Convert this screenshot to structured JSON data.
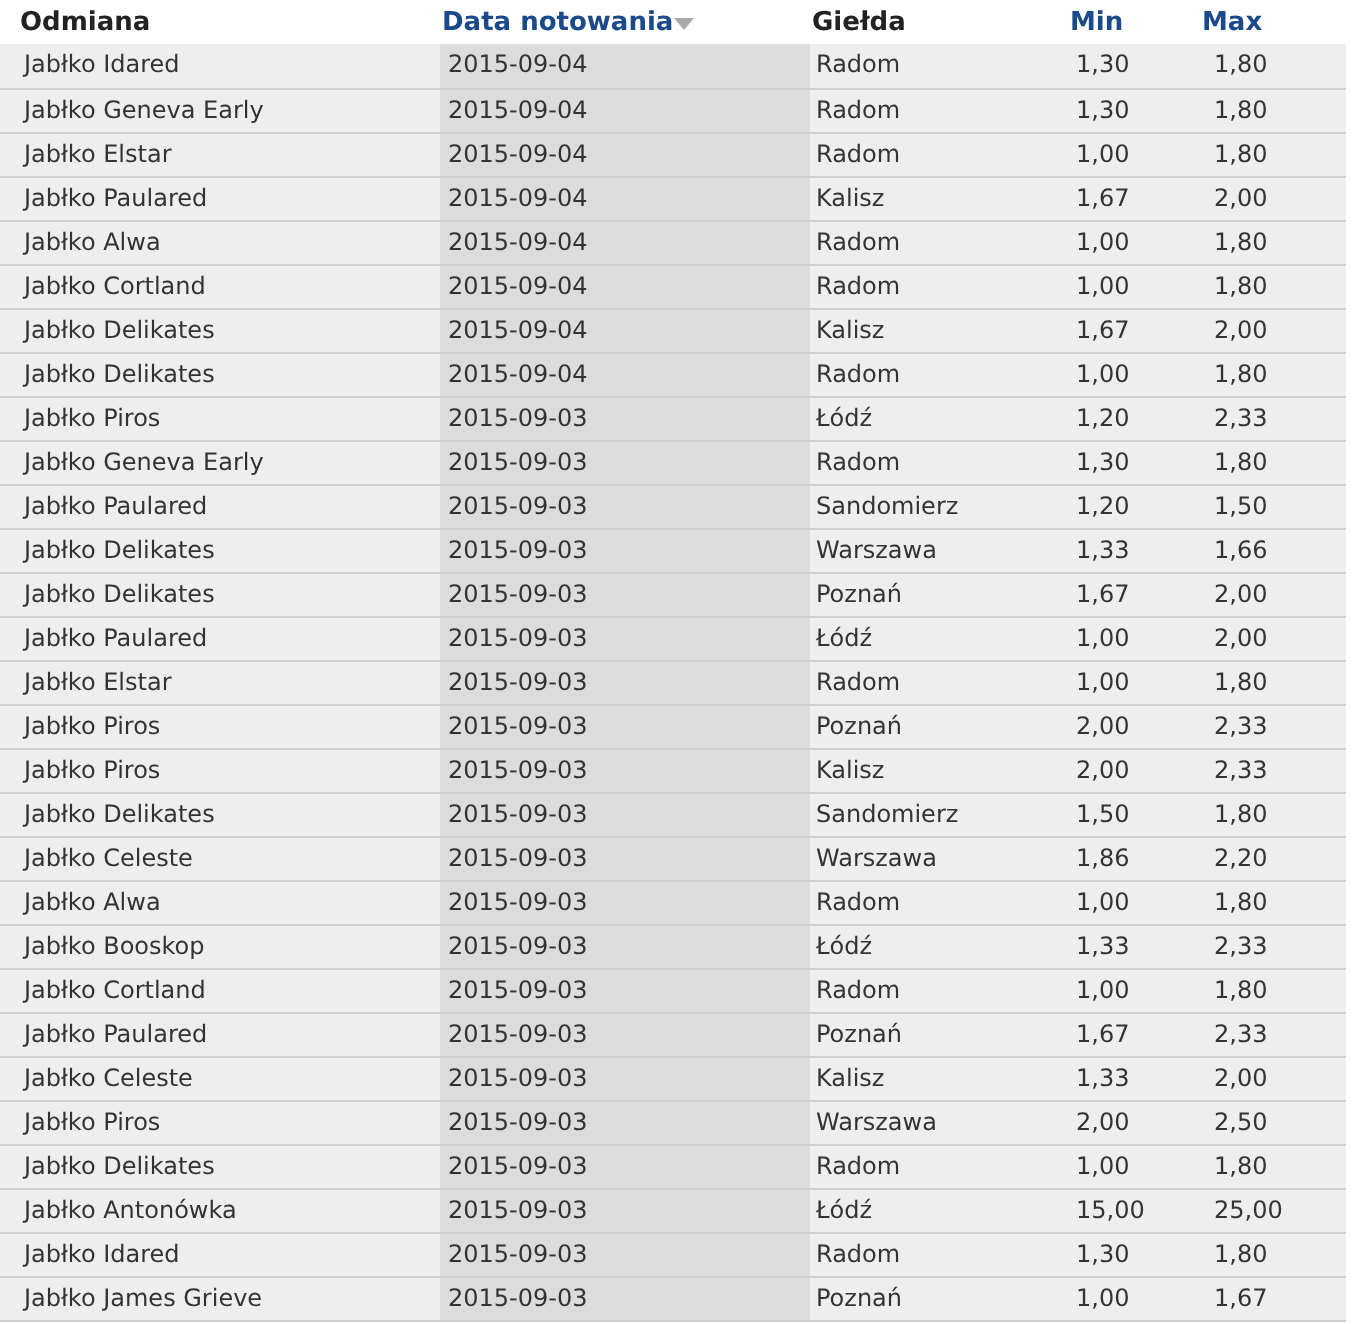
{
  "table": {
    "columns": [
      {
        "label": "Odmiana",
        "sortable": false,
        "sorted": false
      },
      {
        "label": "Data notowania",
        "sortable": true,
        "sorted": true
      },
      {
        "label": "Giełda",
        "sortable": false,
        "sorted": false
      },
      {
        "label": "Min",
        "sortable": true,
        "sorted": false
      },
      {
        "label": "Max",
        "sortable": true,
        "sorted": false
      }
    ],
    "rows": [
      [
        "Jabłko Idared",
        "2015-09-04",
        "Radom",
        "1,30",
        "1,80"
      ],
      [
        "Jabłko Geneva Early",
        "2015-09-04",
        "Radom",
        "1,30",
        "1,80"
      ],
      [
        "Jabłko Elstar",
        "2015-09-04",
        "Radom",
        "1,00",
        "1,80"
      ],
      [
        "Jabłko Paulared",
        "2015-09-04",
        "Kalisz",
        "1,67",
        "2,00"
      ],
      [
        "Jabłko Alwa",
        "2015-09-04",
        "Radom",
        "1,00",
        "1,80"
      ],
      [
        "Jabłko Cortland",
        "2015-09-04",
        "Radom",
        "1,00",
        "1,80"
      ],
      [
        "Jabłko Delikates",
        "2015-09-04",
        "Kalisz",
        "1,67",
        "2,00"
      ],
      [
        "Jabłko Delikates",
        "2015-09-04",
        "Radom",
        "1,00",
        "1,80"
      ],
      [
        "Jabłko Piros",
        "2015-09-03",
        "Łódź",
        "1,20",
        "2,33"
      ],
      [
        "Jabłko Geneva Early",
        "2015-09-03",
        "Radom",
        "1,30",
        "1,80"
      ],
      [
        "Jabłko Paulared",
        "2015-09-03",
        "Sandomierz",
        "1,20",
        "1,50"
      ],
      [
        "Jabłko Delikates",
        "2015-09-03",
        "Warszawa",
        "1,33",
        "1,66"
      ],
      [
        "Jabłko Delikates",
        "2015-09-03",
        "Poznań",
        "1,67",
        "2,00"
      ],
      [
        "Jabłko Paulared",
        "2015-09-03",
        "Łódź",
        "1,00",
        "2,00"
      ],
      [
        "Jabłko Elstar",
        "2015-09-03",
        "Radom",
        "1,00",
        "1,80"
      ],
      [
        "Jabłko Piros",
        "2015-09-03",
        "Poznań",
        "2,00",
        "2,33"
      ],
      [
        "Jabłko Piros",
        "2015-09-03",
        "Kalisz",
        "2,00",
        "2,33"
      ],
      [
        "Jabłko Delikates",
        "2015-09-03",
        "Sandomierz",
        "1,50",
        "1,80"
      ],
      [
        "Jabłko Celeste",
        "2015-09-03",
        "Warszawa",
        "1,86",
        "2,20"
      ],
      [
        "Jabłko Alwa",
        "2015-09-03",
        "Radom",
        "1,00",
        "1,80"
      ],
      [
        "Jabłko Booskop",
        "2015-09-03",
        "Łódź",
        "1,33",
        "2,33"
      ],
      [
        "Jabłko Cortland",
        "2015-09-03",
        "Radom",
        "1,00",
        "1,80"
      ],
      [
        "Jabłko Paulared",
        "2015-09-03",
        "Poznań",
        "1,67",
        "2,33"
      ],
      [
        "Jabłko Celeste",
        "2015-09-03",
        "Kalisz",
        "1,33",
        "2,00"
      ],
      [
        "Jabłko Piros",
        "2015-09-03",
        "Warszawa",
        "2,00",
        "2,50"
      ],
      [
        "Jabłko Delikates",
        "2015-09-03",
        "Radom",
        "1,00",
        "1,80"
      ],
      [
        "Jabłko Antonówka",
        "2015-09-03",
        "Łódź",
        "15,00",
        "25,00"
      ],
      [
        "Jabłko Idared",
        "2015-09-03",
        "Radom",
        "1,30",
        "1,80"
      ],
      [
        "Jabłko James Grieve",
        "2015-09-03",
        "Poznań",
        "1,00",
        "1,67"
      ]
    ]
  }
}
